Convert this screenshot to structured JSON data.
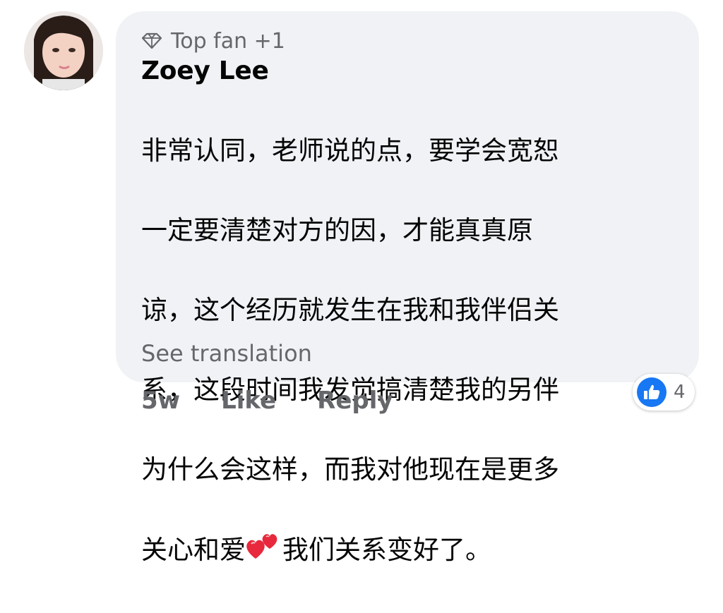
{
  "comment": {
    "badge": "Top fan +1",
    "author": "Zoey Lee",
    "lines": [
      "非常认同，老师说的点，要学会宽恕",
      "一定要清楚对方的因，才能真真原",
      "谅，这个经历就发生在我和我伴侣关",
      "系，这段时间我发觉搞清楚我的另伴",
      "为什么会这样，而我对他现在是更多"
    ],
    "last_line_before_emoji": "关心和爱",
    "last_line_after_emoji": "我们关系变好了。",
    "emoji_icon": "two-hearts-icon",
    "see_translation": "See translation"
  },
  "actions": {
    "time": "5w",
    "like": "Like",
    "reply": "Reply"
  },
  "reactions": {
    "icon": "thumbs-up-icon",
    "count": "4"
  },
  "colors": {
    "bubble": "#f0f2f5",
    "secondary_text": "#65676b",
    "primary_text": "#050505",
    "like_blue": "#1877f2",
    "heart_red": "#e8283c"
  }
}
